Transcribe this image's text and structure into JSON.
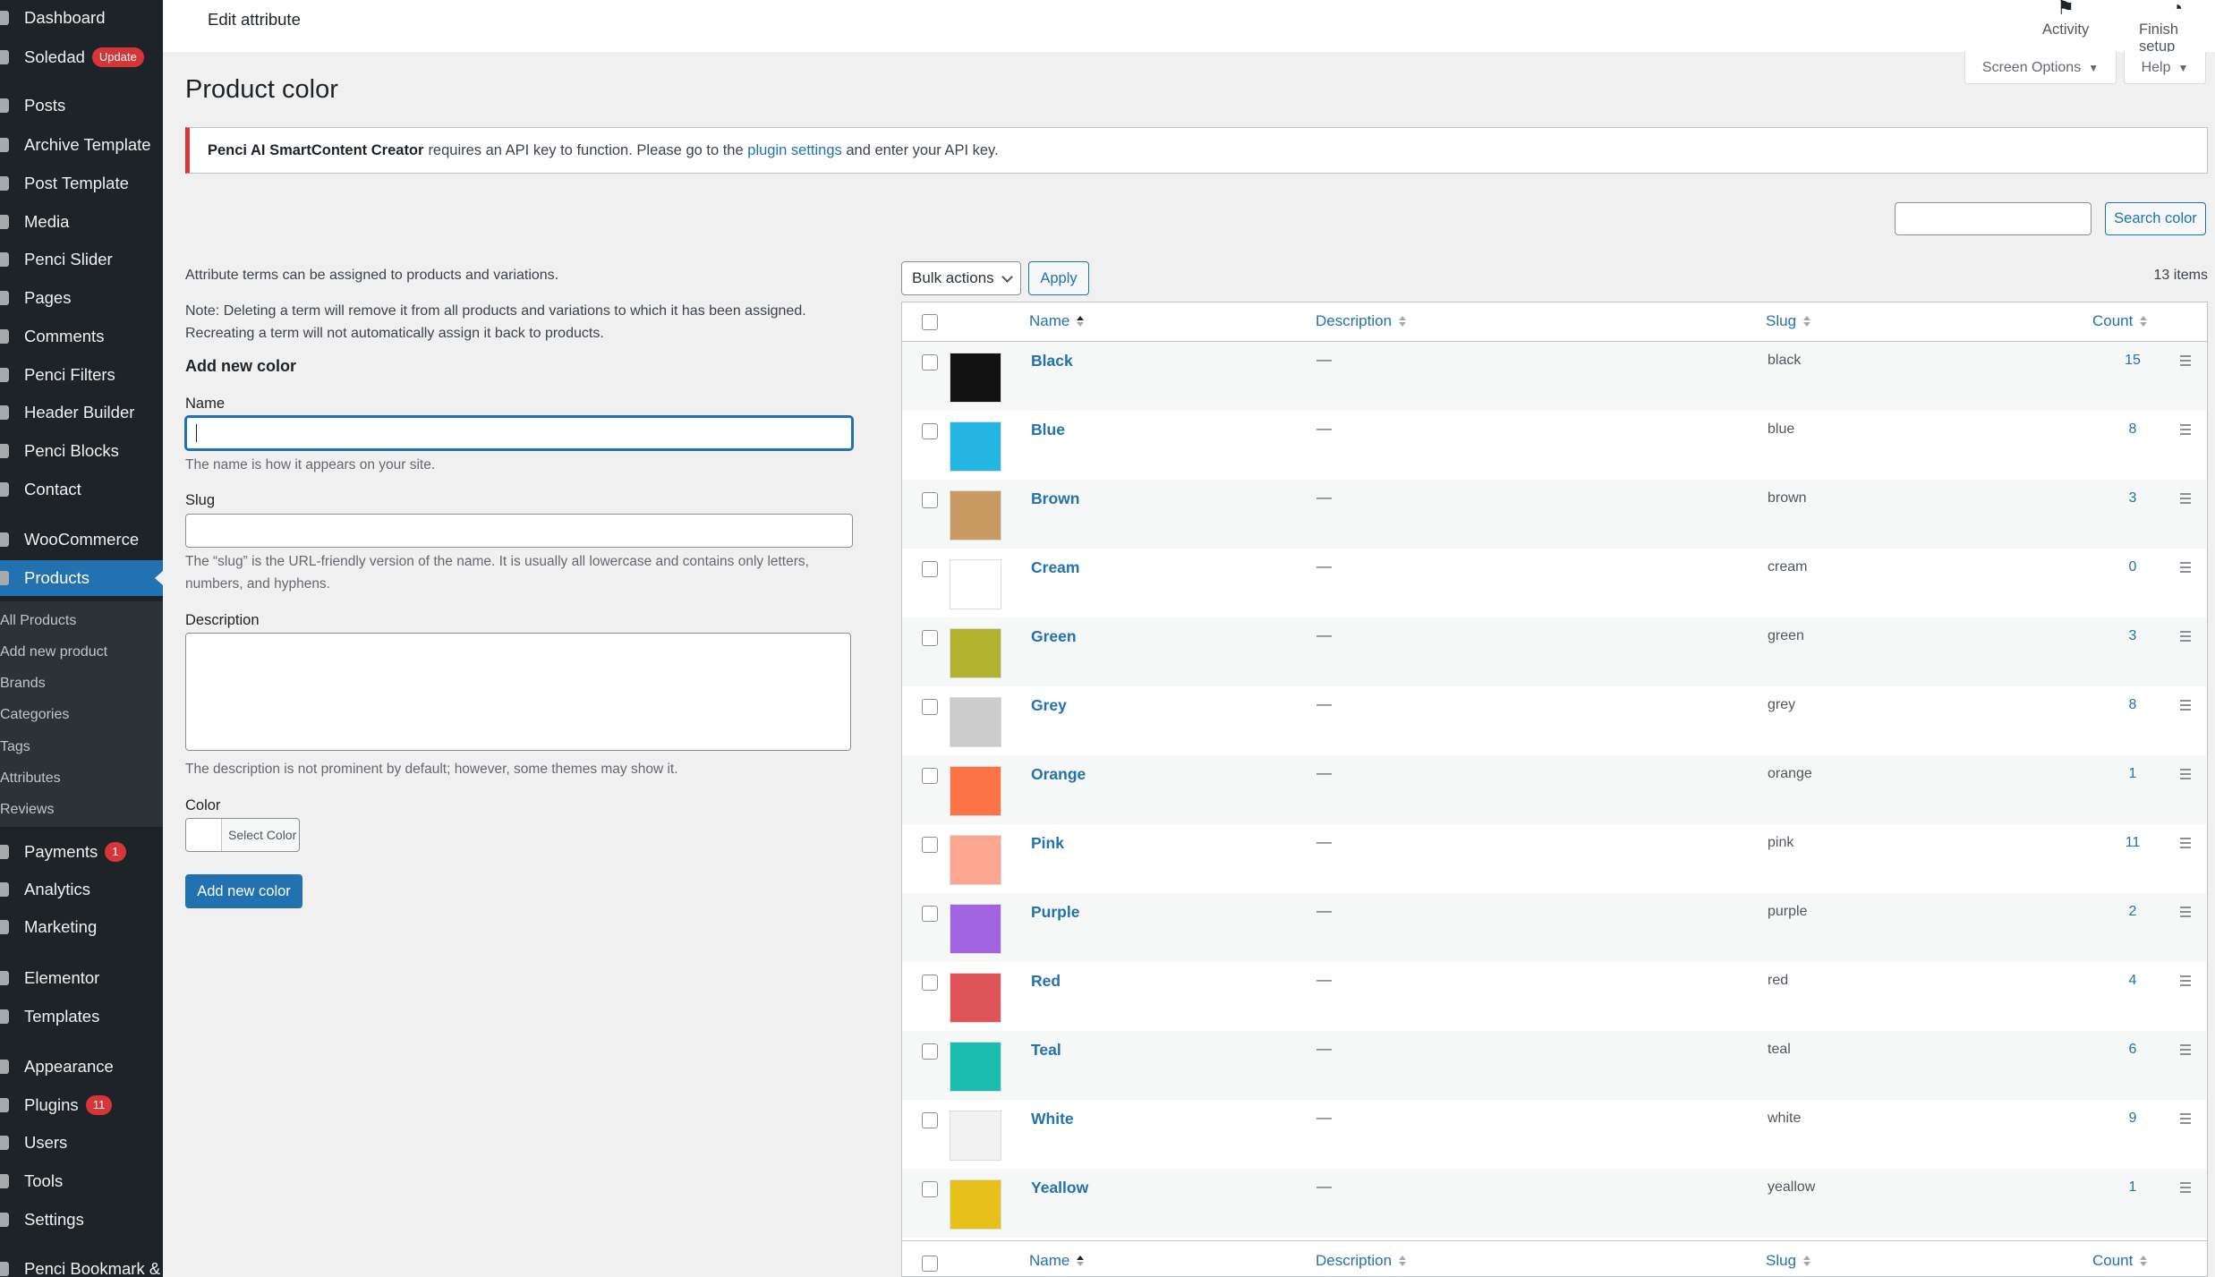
{
  "sidebar": {
    "items": [
      {
        "label": "Dashboard",
        "icon": "dashboard-icon"
      },
      {
        "label": "Soledad",
        "icon": "theme-icon",
        "badge": "Update"
      },
      {
        "label": "Posts",
        "icon": "pin-icon"
      },
      {
        "label": "Archive Template",
        "icon": "template-icon"
      },
      {
        "label": "Post Template",
        "icon": "template-icon"
      },
      {
        "label": "Media",
        "icon": "media-icon"
      },
      {
        "label": "Penci Slider",
        "icon": "slider-icon"
      },
      {
        "label": "Pages",
        "icon": "page-icon"
      },
      {
        "label": "Comments",
        "icon": "comment-icon"
      },
      {
        "label": "Penci Filters",
        "icon": "filter-icon"
      },
      {
        "label": "Header Builder",
        "icon": "header-icon"
      },
      {
        "label": "Penci Blocks",
        "icon": "blocks-icon"
      },
      {
        "label": "Contact",
        "icon": "mail-icon"
      },
      {
        "label": "WooCommerce",
        "icon": "woocommerce-icon"
      },
      {
        "label": "Products",
        "icon": "products-icon"
      },
      {
        "label": "Payments",
        "icon": "payments-icon",
        "badge": "1"
      },
      {
        "label": "Analytics",
        "icon": "analytics-icon"
      },
      {
        "label": "Marketing",
        "icon": "marketing-icon"
      },
      {
        "label": "Elementor",
        "icon": "elementor-icon"
      },
      {
        "label": "Templates",
        "icon": "folder-icon"
      },
      {
        "label": "Appearance",
        "icon": "brush-icon"
      },
      {
        "label": "Plugins",
        "icon": "plugin-icon",
        "badge": "11"
      },
      {
        "label": "Users",
        "icon": "user-icon"
      },
      {
        "label": "Tools",
        "icon": "wrench-icon"
      },
      {
        "label": "Settings",
        "icon": "settings-icon"
      },
      {
        "label": "Penci Bookmark &",
        "icon": "bookmark-icon"
      }
    ],
    "submenu": [
      "All Products",
      "Add new product",
      "Brands",
      "Categories",
      "Tags",
      "Attributes",
      "Reviews"
    ]
  },
  "header": {
    "title": "Edit attribute",
    "activity_label": "Activity",
    "finish_label": "Finish setup",
    "screen_options": "Screen Options",
    "help": "Help"
  },
  "page_title": "Product color",
  "notice": {
    "plugin_name": "Penci AI SmartContent Creator",
    "text_before": "requires an API key to function. Please go to the",
    "link": "plugin settings",
    "text_after": "and enter your API key."
  },
  "search": {
    "button": "Search color",
    "value": ""
  },
  "form": {
    "intro": "Attribute terms can be assigned to products and variations.",
    "note_line1": "Note: Deleting a term will remove it from all products and variations to which it has been assigned.",
    "note_line2": "Recreating a term will not automatically assign it back to products.",
    "heading": "Add new color",
    "name_label": "Name",
    "name_hint": "The name is how it appears on your site.",
    "slug_label": "Slug",
    "slug_hint_line1": "The “slug” is the URL-friendly version of the name. It is usually all lowercase and contains only letters,",
    "slug_hint_line2": "numbers, and hyphens.",
    "description_label": "Description",
    "description_hint": "The description is not prominent by default; however, some themes may show it.",
    "color_label": "Color",
    "select_color": "Select Color",
    "submit": "Add new color"
  },
  "table": {
    "bulk_actions": "Bulk actions",
    "apply": "Apply",
    "items_count": "13 items",
    "columns": {
      "name": "Name",
      "description": "Description",
      "slug": "Slug",
      "count": "Count"
    },
    "rows": [
      {
        "name": "Black",
        "description": "—",
        "slug": "black",
        "count": "15",
        "color": "#111111"
      },
      {
        "name": "Blue",
        "description": "—",
        "slug": "blue",
        "count": "8",
        "color": "#23b6e3"
      },
      {
        "name": "Brown",
        "description": "—",
        "slug": "brown",
        "count": "3",
        "color": "#c99964"
      },
      {
        "name": "Cream",
        "description": "—",
        "slug": "cream",
        "count": "0",
        "color": "#ffffff"
      },
      {
        "name": "Green",
        "description": "—",
        "slug": "green",
        "count": "3",
        "color": "#b0b22e"
      },
      {
        "name": "Grey",
        "description": "—",
        "slug": "grey",
        "count": "8",
        "color": "#cccccc"
      },
      {
        "name": "Orange",
        "description": "—",
        "slug": "orange",
        "count": "1",
        "color": "#fc7346"
      },
      {
        "name": "Pink",
        "description": "—",
        "slug": "pink",
        "count": "11",
        "color": "#fca58f"
      },
      {
        "name": "Purple",
        "description": "—",
        "slug": "purple",
        "count": "2",
        "color": "#a264e0"
      },
      {
        "name": "Red",
        "description": "—",
        "slug": "red",
        "count": "4",
        "color": "#df5458"
      },
      {
        "name": "Teal",
        "description": "—",
        "slug": "teal",
        "count": "6",
        "color": "#1bbdb0"
      },
      {
        "name": "White",
        "description": "—",
        "slug": "white",
        "count": "9",
        "color": "#f2f2f2"
      },
      {
        "name": "Yeallow",
        "description": "—",
        "slug": "yeallow",
        "count": "1",
        "color": "#e8c01a"
      }
    ]
  }
}
